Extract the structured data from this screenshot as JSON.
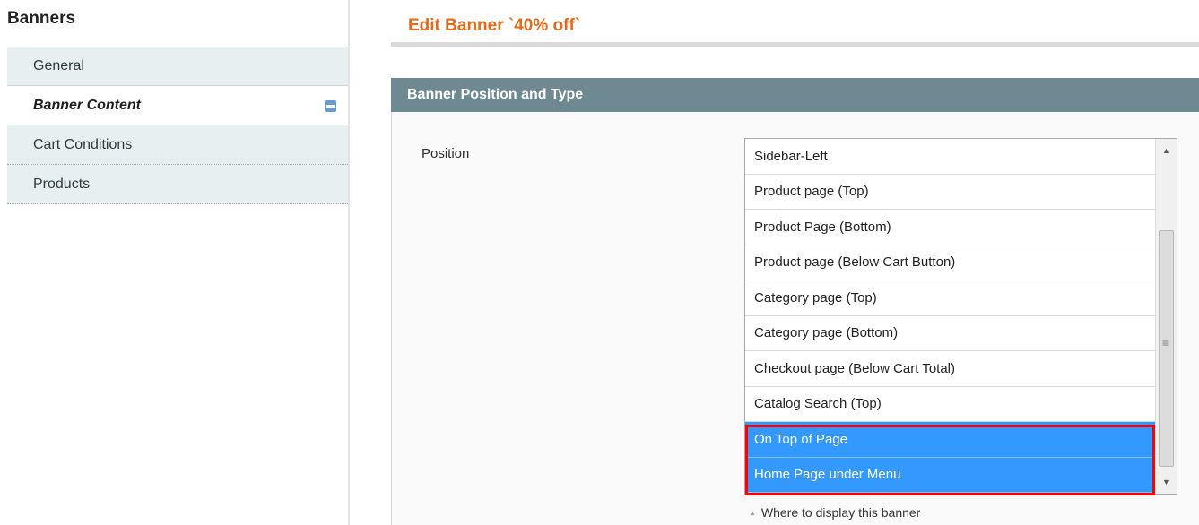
{
  "sidebar": {
    "title": "Banners",
    "tabs": [
      {
        "label": "General"
      },
      {
        "label": "Banner Content"
      },
      {
        "label": "Cart Conditions"
      },
      {
        "label": "Products"
      }
    ]
  },
  "main": {
    "page_title": "Edit Banner `40% off`",
    "section_title": "Banner Position and Type",
    "position": {
      "label": "Position",
      "options": [
        "Sidebar-Left",
        "Product page (Top)",
        "Product Page (Bottom)",
        "Product page (Below Cart Button)",
        "Category page (Top)",
        "Category page (Bottom)",
        "Checkout page (Below Cart Total)",
        "Catalog Search (Top)",
        "On Top of Page",
        "Home Page under Menu"
      ],
      "selected": [
        "On Top of Page",
        "Home Page under Menu"
      ],
      "hint": "Where to display this banner"
    }
  },
  "colors": {
    "accent": "#e16a1b",
    "section_header": "#6f8992",
    "selection": "#3399ff",
    "highlight_frame": "#ff0000"
  }
}
